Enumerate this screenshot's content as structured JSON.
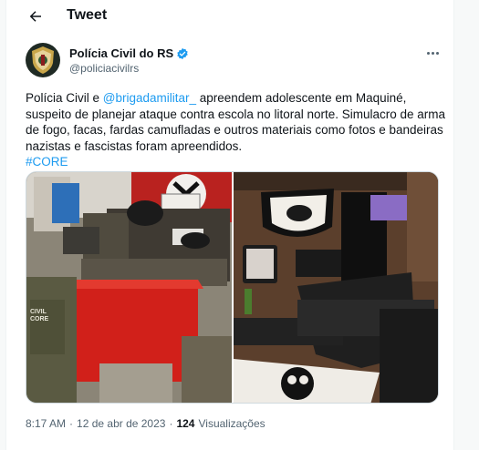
{
  "header": {
    "title": "Tweet"
  },
  "author": {
    "name": "Polícia Civil do RS",
    "handle": "@policiacivilrs"
  },
  "tweet": {
    "text_part1": "Polícia Civil e ",
    "mention": "@brigadamilitar_",
    "text_part2": " apreendem adolescente em Maquiné, suspeito de planejar ataque contra escola no litoral norte. Simulacro de arma de fogo, facas, fardas camufladas e outros materiais como fotos e bandeiras nazistas e fascistas foram apreendidos.",
    "hashtag": "#CORE"
  },
  "photos": {
    "patch_label": "CORE",
    "patch_label_2": "CIVIL"
  },
  "meta": {
    "time": "8:17 AM",
    "date": "12 de abr de 2023",
    "separator": "·",
    "views_count": "124",
    "views_label": "Visualizações"
  },
  "colors": {
    "accent": "#1d9bf0",
    "verified": "#1d9bf0",
    "text": "#0f1419",
    "muted": "#536471"
  },
  "icons": {
    "back": "arrow-left-icon",
    "verified": "verified-badge-icon",
    "more": "more-horizontal-icon"
  }
}
